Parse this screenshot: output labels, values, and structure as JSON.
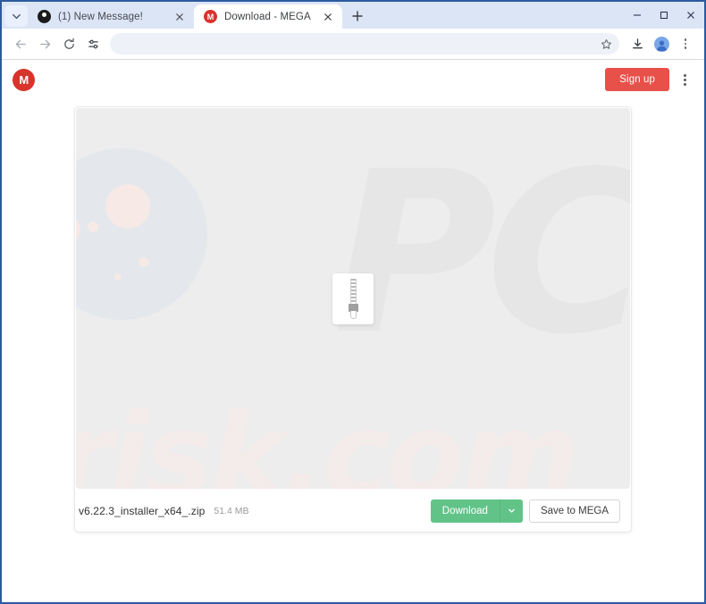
{
  "browser": {
    "tab_search_icon": "chevron-down-icon",
    "tabs": [
      {
        "title": "(1) New Message!",
        "favicon": "dark-circle-icon",
        "active": false
      },
      {
        "title": "Download - MEGA",
        "favicon": "mega-m-icon",
        "active": true
      }
    ],
    "new_tab_label": "+",
    "window_controls": {
      "minimize": "minimize-icon",
      "maximize": "maximize-icon",
      "close": "close-icon"
    },
    "toolbar": {
      "back": "back-arrow-icon",
      "forward": "forward-arrow-icon",
      "reload": "reload-icon",
      "tune": "tune-icon",
      "address_value": "",
      "address_placeholder": "",
      "bookmark": "star-icon",
      "downloads": "download-tray-icon",
      "profile": "profile-avatar-icon",
      "menu": "three-dot-menu-icon"
    }
  },
  "page": {
    "logo_letter": "M",
    "logo_name": "mega-logo",
    "signup_label": "Sign up",
    "header_menu": "three-dot-menu-icon",
    "preview": {
      "file_icon": "zip-file-icon",
      "watermark_pc": "PC",
      "watermark_risk": "risk.com"
    },
    "file": {
      "name": "v6.22.3_installer_x64_.zip",
      "size": "51.4 MB"
    },
    "actions": {
      "download_label": "Download",
      "download_caret": "chevron-down-icon",
      "save_label": "Save to MEGA"
    }
  },
  "colors": {
    "window_frame": "#2c5a9e",
    "tabstrip": "#dce5f6",
    "mega_red": "#d9332b",
    "signup_red": "#e8514a",
    "download_green": "#62c389",
    "preview_bg": "#ededed"
  }
}
